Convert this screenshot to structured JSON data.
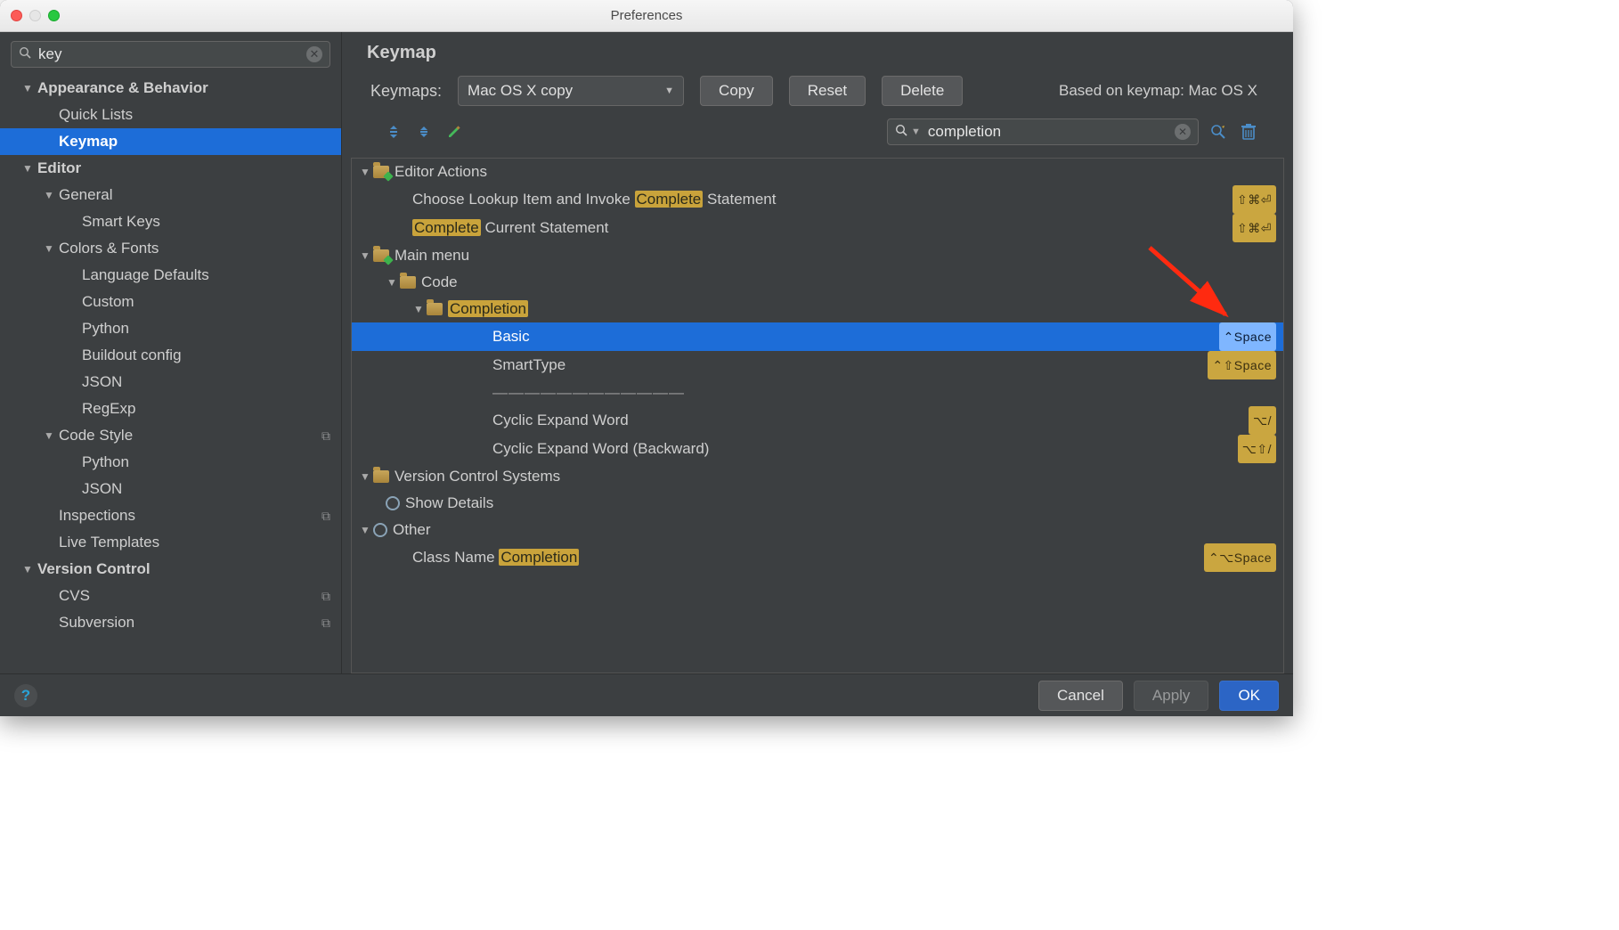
{
  "window": {
    "title": "Preferences"
  },
  "sidebar": {
    "search_value": "key",
    "items": [
      {
        "label": "Appearance & Behavior",
        "indent": 0,
        "expanded": true,
        "bold": true
      },
      {
        "label": "Quick Lists",
        "indent": 1
      },
      {
        "label": "Keymap",
        "indent": 1,
        "selected": true,
        "bold": true
      },
      {
        "label": "Editor",
        "indent": 0,
        "expanded": true,
        "bold": true
      },
      {
        "label": "General",
        "indent": 1,
        "expanded": true
      },
      {
        "label": "Smart Keys",
        "indent": 2
      },
      {
        "label": "Colors & Fonts",
        "indent": 1,
        "expanded": true
      },
      {
        "label": "Language Defaults",
        "indent": 2
      },
      {
        "label": "Custom",
        "indent": 2
      },
      {
        "label": "Python",
        "indent": 2
      },
      {
        "label": "Buildout config",
        "indent": 2
      },
      {
        "label": "JSON",
        "indent": 2
      },
      {
        "label": "RegExp",
        "indent": 2
      },
      {
        "label": "Code Style",
        "indent": 1,
        "expanded": true,
        "copy": true
      },
      {
        "label": "Python",
        "indent": 2
      },
      {
        "label": "JSON",
        "indent": 2
      },
      {
        "label": "Inspections",
        "indent": 1,
        "copy": true
      },
      {
        "label": "Live Templates",
        "indent": 1
      },
      {
        "label": "Version Control",
        "indent": 0,
        "expanded": true,
        "bold": true
      },
      {
        "label": "CVS",
        "indent": 1,
        "copy": true
      },
      {
        "label": "Subversion",
        "indent": 1,
        "copy": true
      }
    ]
  },
  "main": {
    "title": "Keymap",
    "keymaps_label": "Keymaps:",
    "keymaps_value": "Mac OS X copy",
    "buttons": {
      "copy": "Copy",
      "reset": "Reset",
      "delete": "Delete"
    },
    "based_on_label": "Based on keymap: Mac OS X",
    "filter_value": "completion",
    "rows": [
      {
        "type": "group",
        "label": "Editor Actions",
        "indent": 0,
        "expanded": true,
        "icon": "folder-pen"
      },
      {
        "type": "action",
        "indent": 2,
        "pre": "Choose Lookup Item and Invoke ",
        "hl": "Complete",
        "post": " Statement",
        "shortcut": "⇧⌘⏎"
      },
      {
        "type": "action",
        "indent": 2,
        "hl": "Complete",
        "post": " Current Statement",
        "shortcut": "⇧⌘⏎"
      },
      {
        "type": "group",
        "label": "Main menu",
        "indent": 0,
        "expanded": true,
        "icon": "folder-pen"
      },
      {
        "type": "group",
        "label": "Code",
        "indent": 1,
        "expanded": true,
        "icon": "folder"
      },
      {
        "type": "group",
        "indent": 2,
        "expanded": true,
        "icon": "folder",
        "hl": "Completion"
      },
      {
        "type": "action",
        "indent": 4,
        "label": "Basic",
        "selected": true,
        "shortcut": "⌃Space"
      },
      {
        "type": "action",
        "indent": 4,
        "label": "SmartType",
        "shortcut": "⌃⇧Space"
      },
      {
        "type": "sep",
        "indent": 4,
        "label": "————————————"
      },
      {
        "type": "action",
        "indent": 4,
        "label": "Cyclic Expand Word",
        "shortcut": "⌥/"
      },
      {
        "type": "action",
        "indent": 4,
        "label": "Cyclic Expand Word (Backward)",
        "shortcut": "⌥⇧/"
      },
      {
        "type": "group",
        "label": "Version Control Systems",
        "indent": 0,
        "expanded": true,
        "icon": "folder"
      },
      {
        "type": "action",
        "indent": 1,
        "label": "Show Details",
        "icon": "gear"
      },
      {
        "type": "group",
        "label": "Other",
        "indent": 0,
        "expanded": true,
        "icon": "gear"
      },
      {
        "type": "action",
        "indent": 2,
        "pre": "Class Name ",
        "hl": "Completion",
        "shortcut": "⌃⌥Space"
      }
    ]
  },
  "footer": {
    "cancel": "Cancel",
    "apply": "Apply",
    "ok": "OK"
  }
}
